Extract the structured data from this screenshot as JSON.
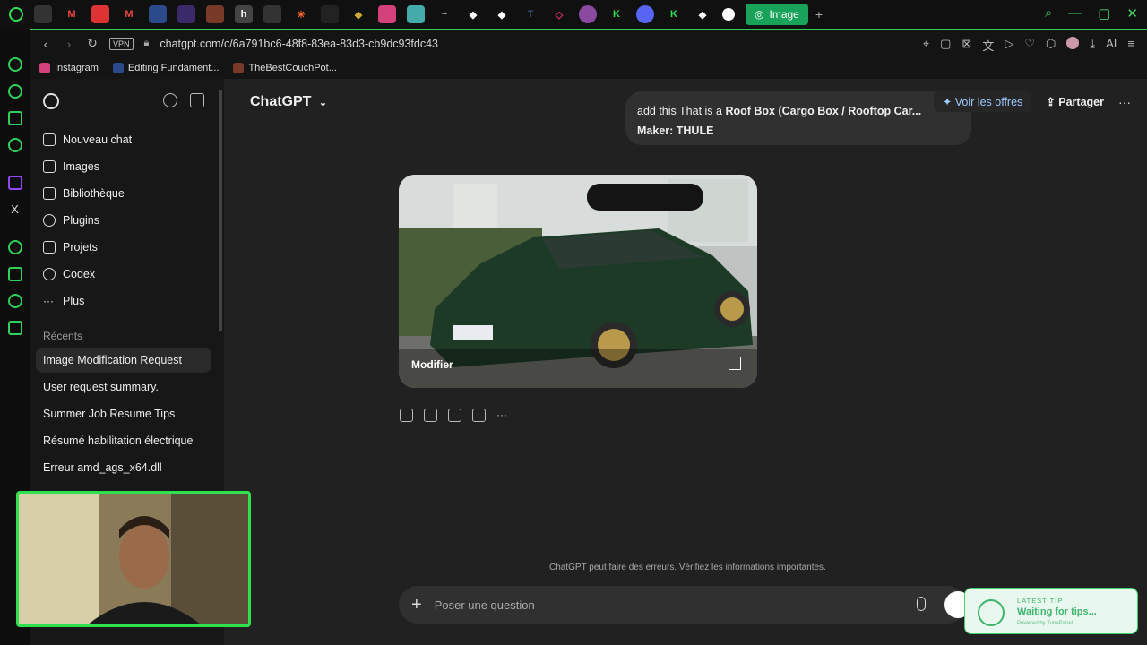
{
  "browser": {
    "active_tab_label": "Image",
    "url": "chatgpt.com/c/6a791bc6-48f8-83ea-83d3-cb9dc93fdc43",
    "vpn_label": "VPN",
    "ai_label": "AI",
    "bookmarks": [
      "Instagram",
      "Editing Fundament...",
      "TheBestCouchPot..."
    ]
  },
  "sidebar": {
    "nav": [
      "Nouveau chat",
      "Images",
      "Bibliothèque",
      "Plugins",
      "Projets",
      "Codex",
      "Plus"
    ],
    "section_label": "Récents",
    "recents": [
      "Image Modification Request",
      "User request summary.",
      "Summer Job Resume Tips",
      "Résumé habilitation électrique",
      "Erreur amd_ags_x64.dll"
    ]
  },
  "main": {
    "model_name": "ChatGPT",
    "offer_label": "Voir les offres",
    "share_label": "Partager",
    "user_message_1": "add this That is a ",
    "user_message_bold": "Roof Box (Cargo Box / Rooftop Car...",
    "user_message_2": "Maker: THULE",
    "modify_label": "Modifier",
    "disclaimer": "ChatGPT peut faire des erreurs. Vérifiez les informations importantes.",
    "composer_placeholder": "Poser une question"
  },
  "tip": {
    "label": "LATEST TIP",
    "text": "Waiting for tips...",
    "sub": "Powered by TunaPanel"
  }
}
